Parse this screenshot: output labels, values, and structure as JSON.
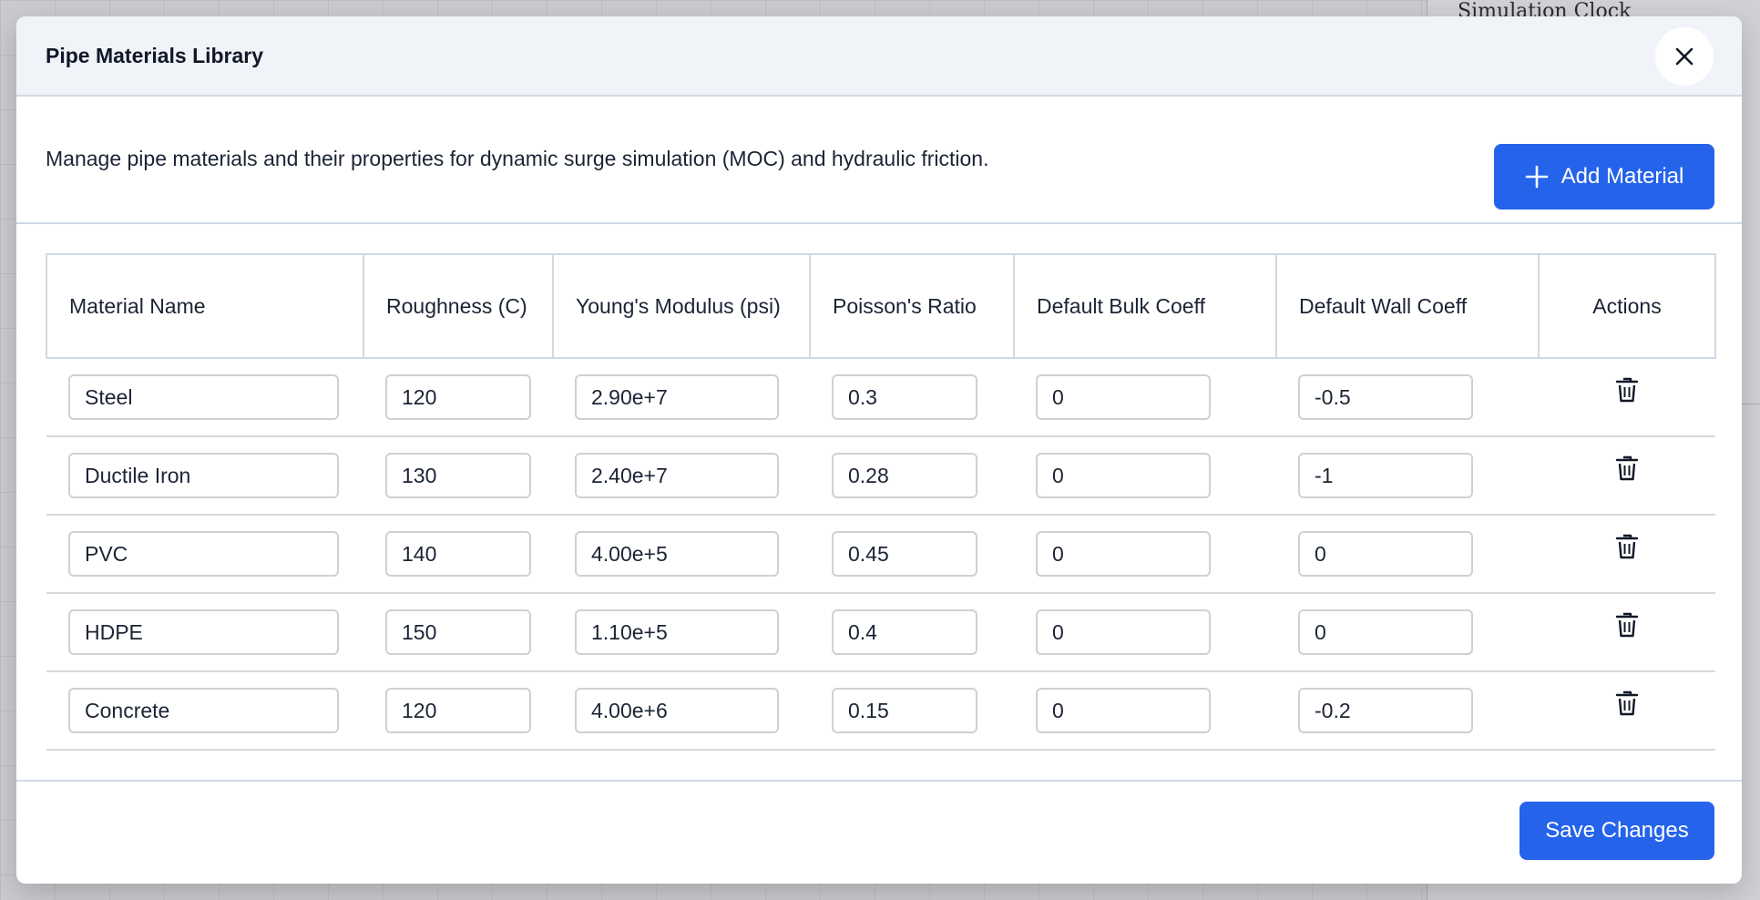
{
  "background": {
    "panel_title": "Simulation Clock"
  },
  "modal": {
    "title": "Pipe Materials Library",
    "close_icon": "close-icon",
    "description": "Manage pipe materials and their properties for dynamic surge simulation (MOC) and hydraulic friction.",
    "add_button_label": "Add Material",
    "add_button_icon": "plus-icon",
    "save_button_label": "Save Changes",
    "accent_color": "#2563eb"
  },
  "table": {
    "headers": {
      "name": "Material Name",
      "roughness": "Roughness (C)",
      "young": "Young's Modulus (psi)",
      "poisson": "Poisson's Ratio",
      "bulk": "Default Bulk Coeff",
      "wall": "Default Wall Coeff",
      "actions": "Actions"
    },
    "row_action_icon": "trash-icon",
    "rows": [
      {
        "name": "Steel",
        "roughness": "120",
        "young": "2.90e+7",
        "poisson": "0.3",
        "bulk": "0",
        "wall": "-0.5"
      },
      {
        "name": "Ductile Iron",
        "roughness": "130",
        "young": "2.40e+7",
        "poisson": "0.28",
        "bulk": "0",
        "wall": "-1"
      },
      {
        "name": "PVC",
        "roughness": "140",
        "young": "4.00e+5",
        "poisson": "0.45",
        "bulk": "0",
        "wall": "0"
      },
      {
        "name": "HDPE",
        "roughness": "150",
        "young": "1.10e+5",
        "poisson": "0.4",
        "bulk": "0",
        "wall": "0"
      },
      {
        "name": "Concrete",
        "roughness": "120",
        "young": "4.00e+6",
        "poisson": "0.15",
        "bulk": "0",
        "wall": "-0.2"
      }
    ]
  }
}
